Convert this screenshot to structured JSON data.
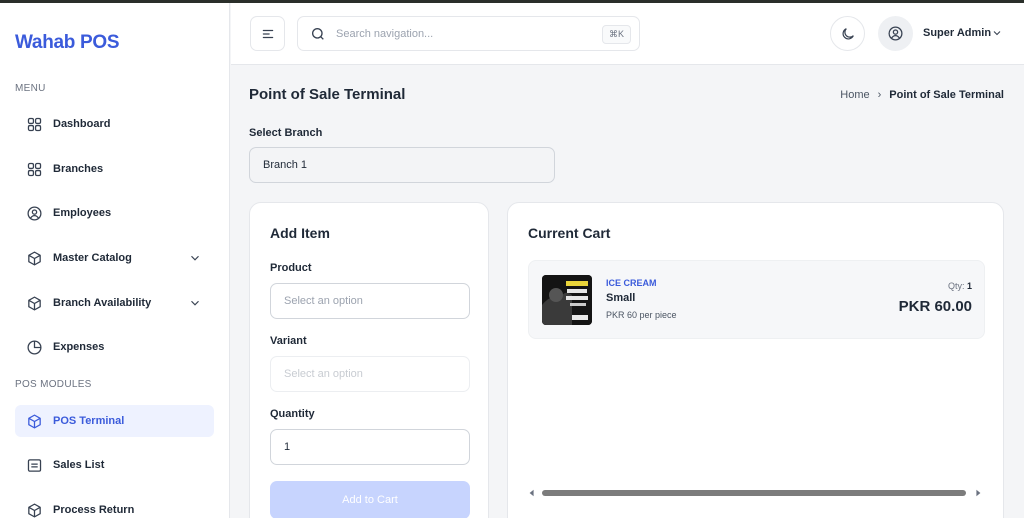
{
  "app": {
    "brand": "Wahab POS"
  },
  "sidebar": {
    "sections": {
      "menu": "MENU",
      "pos_modules": "POS MODULES"
    },
    "items": [
      {
        "label": "Dashboard",
        "icon": "grid-icon"
      },
      {
        "label": "Branches",
        "icon": "grid-icon"
      },
      {
        "label": "Employees",
        "icon": "user-circle-icon"
      },
      {
        "label": "Master Catalog",
        "icon": "box-icon",
        "expandable": true
      },
      {
        "label": "Branch Availability",
        "icon": "box-icon",
        "expandable": true
      },
      {
        "label": "Expenses",
        "icon": "pie-chart-icon"
      },
      {
        "label": "POS Terminal",
        "icon": "box-icon",
        "active": true
      },
      {
        "label": "Sales List",
        "icon": "list-icon"
      },
      {
        "label": "Process Return",
        "icon": "box-icon"
      }
    ]
  },
  "header": {
    "search": {
      "placeholder": "Search navigation...",
      "shortcut": "⌘K"
    },
    "user": {
      "name": "Super Admin"
    }
  },
  "main": {
    "title": "Point of Sale Terminal",
    "breadcrumb": {
      "home": "Home",
      "separator": "›",
      "current": "Point of Sale Terminal"
    },
    "branch": {
      "label": "Select Branch",
      "value": "Branch 1"
    },
    "add_item": {
      "title": "Add Item",
      "product": {
        "label": "Product",
        "placeholder": "Select an option"
      },
      "variant": {
        "label": "Variant",
        "placeholder": "Select an option"
      },
      "quantity": {
        "label": "Quantity",
        "value": "1"
      },
      "button": "Add to Cart"
    },
    "cart": {
      "title": "Current Cart",
      "items": [
        {
          "category": "ICE CREAM",
          "name": "Small",
          "unit_price": "PKR 60 per piece",
          "qty_label": "Qty:",
          "qty": "1",
          "total": "PKR 60.00"
        }
      ]
    }
  },
  "colors": {
    "accent": "#3b5bdb",
    "active_bg": "#eef2ff",
    "button_disabled": "#c7d4fe"
  }
}
